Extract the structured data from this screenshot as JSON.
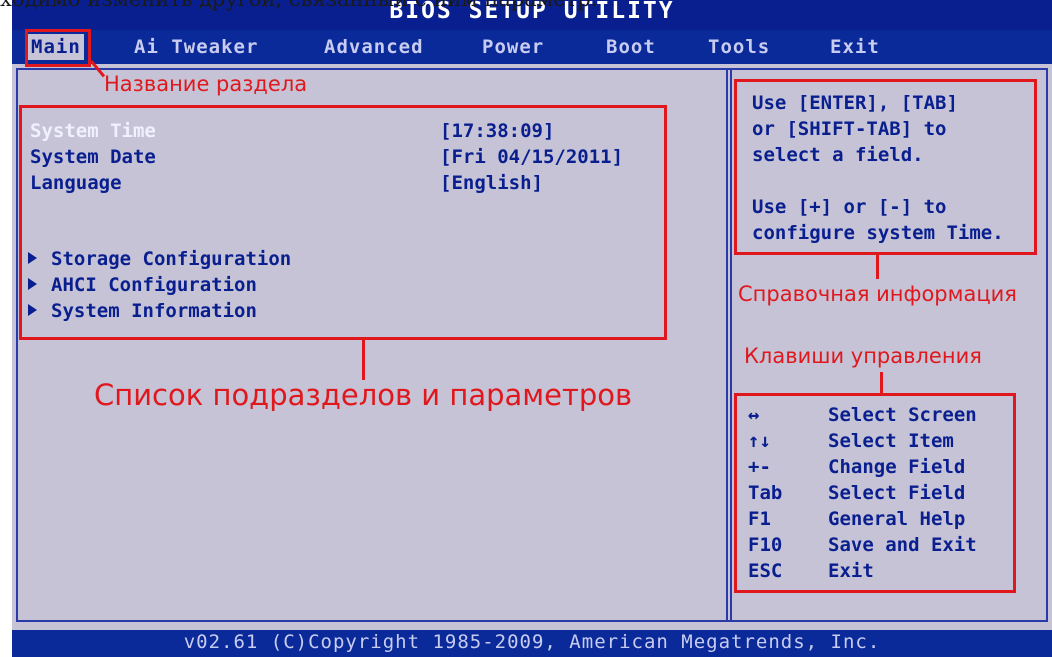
{
  "caption_top": "ходимо изменить другой, связанный с ним параметр.",
  "bios": {
    "title": "BIOS SETUP UTILITY",
    "menu": [
      {
        "label": "Main",
        "active": true
      },
      {
        "label": "Ai Tweaker",
        "active": false
      },
      {
        "label": "Advanced",
        "active": false
      },
      {
        "label": "Power",
        "active": false
      },
      {
        "label": "Boot",
        "active": false
      },
      {
        "label": "Tools",
        "active": false
      },
      {
        "label": "Exit",
        "active": false
      }
    ],
    "settings": [
      {
        "label": "System Time",
        "value": "[17:38:09]",
        "selected": true
      },
      {
        "label": "System Date",
        "value": "[Fri 04/15/2011]",
        "selected": false
      },
      {
        "label": "Language",
        "value": "[English]",
        "selected": false
      }
    ],
    "submenus": [
      "Storage Configuration",
      "AHCI Configuration",
      "System Information"
    ],
    "help_text": [
      "Use [ENTER], [TAB]",
      "or [SHIFT-TAB] to",
      "select a field.",
      "",
      "Use [+] or [-] to",
      "configure system Time."
    ],
    "keys": [
      {
        "key": "↔",
        "desc": "Select Screen"
      },
      {
        "key": "↑↓",
        "desc": "Select Item"
      },
      {
        "key": "+-",
        "desc": "Change Field"
      },
      {
        "key": "Tab",
        "desc": "Select Field"
      },
      {
        "key": "F1",
        "desc": "General Help"
      },
      {
        "key": "F10",
        "desc": "Save and Exit"
      },
      {
        "key": "ESC",
        "desc": "Exit"
      }
    ],
    "copyright": "v02.61 (C)Copyright 1985-2009, American Megatrends, Inc."
  },
  "annotations": {
    "section_name": "Название раздела",
    "reference_info": "Справочная информация",
    "control_keys": "Клавиши управления",
    "list": "Список подразделов и параметров"
  },
  "colors": {
    "bios_blue": "#0a2a99",
    "panel_gray": "#c5c3d5",
    "annotation_red": "#e0181e"
  }
}
